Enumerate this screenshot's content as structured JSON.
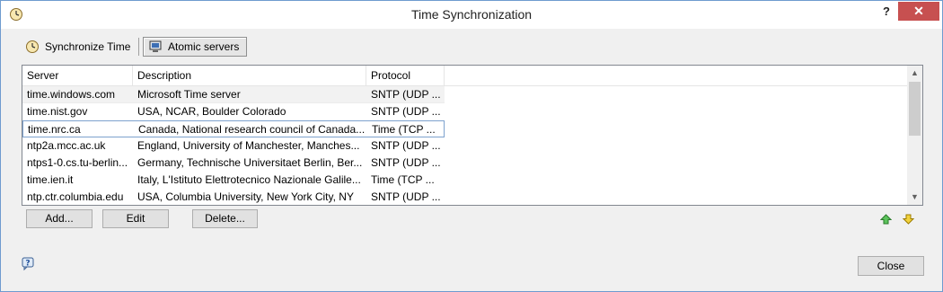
{
  "window": {
    "title": "Time Synchronization",
    "help_label": "?",
    "close_label": "✕"
  },
  "tabs": [
    {
      "label": "Synchronize Time",
      "icon": "clock-icon",
      "active": false
    },
    {
      "label": "Atomic servers",
      "icon": "computer-icon",
      "active": true
    }
  ],
  "table": {
    "columns": [
      "Server",
      "Description",
      "Protocol"
    ],
    "rows": [
      {
        "server": "time.windows.com",
        "description": "Microsoft Time server",
        "protocol": "SNTP (UDP ..."
      },
      {
        "server": "time.nist.gov",
        "description": "USA, NCAR, Boulder Colorado",
        "protocol": "SNTP (UDP ..."
      },
      {
        "server": "time.nrc.ca",
        "description": "Canada, National research council of Canada...",
        "protocol": "Time (TCP ..."
      },
      {
        "server": "ntp2a.mcc.ac.uk",
        "description": "England, University of Manchester, Manches...",
        "protocol": "SNTP (UDP ..."
      },
      {
        "server": "ntps1-0.cs.tu-berlin...",
        "description": "Germany, Technische Universitaet Berlin, Ber...",
        "protocol": "SNTP (UDP ..."
      },
      {
        "server": "time.ien.it",
        "description": "Italy, L'Istituto Elettrotecnico Nazionale Galile...",
        "protocol": "Time (TCP ..."
      },
      {
        "server": "ntp.ctr.columbia.edu",
        "description": "USA, Columbia University, New York City, NY",
        "protocol": "SNTP (UDP ..."
      }
    ]
  },
  "buttons": {
    "add": "Add...",
    "edit": "Edit",
    "delete": "Delete...",
    "close": "Close"
  },
  "icons": {
    "move_up": "arrow-up-icon",
    "move_down": "arrow-down-icon",
    "help": "help-icon"
  },
  "colors": {
    "accent_border": "#7da2ce",
    "close_button_bg": "#c75050",
    "arrow_up": "#3aa53a",
    "arrow_down": "#e0b800"
  }
}
